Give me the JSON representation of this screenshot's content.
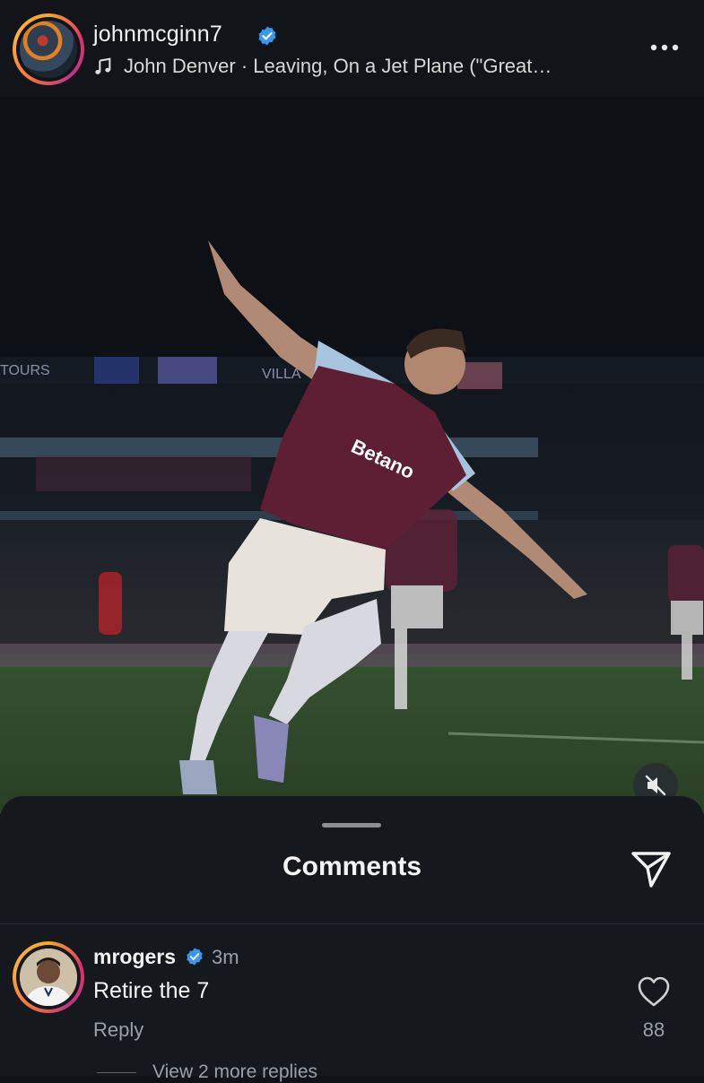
{
  "post": {
    "username": "johnmcginn7",
    "verified": true,
    "audio": "John Denver · Leaving, On a Jet Plane (\"Great…"
  },
  "photo": {
    "alt": "",
    "shirt_sponsor": "Betano",
    "stand_text_left": "TOURS",
    "stand_text_right": "VILLA"
  },
  "comments_sheet": {
    "title": "Comments",
    "comments": [
      {
        "username": "mrogers",
        "verified": true,
        "time": "3m",
        "text": "Retire the 7",
        "reply_label": "Reply",
        "likes": "88",
        "more_replies_label": "View 2 more replies"
      }
    ]
  },
  "colors": {
    "background": "#0f1216",
    "sheet": "#15191e",
    "verified_blue": "#3897f0",
    "muted_text": "#9aa0a6"
  },
  "icons": {
    "audio": "music-note-icon",
    "more": "more-horizontal-icon",
    "share": "paper-plane-icon",
    "like": "heart-icon",
    "mute": "speaker-muted-icon"
  }
}
